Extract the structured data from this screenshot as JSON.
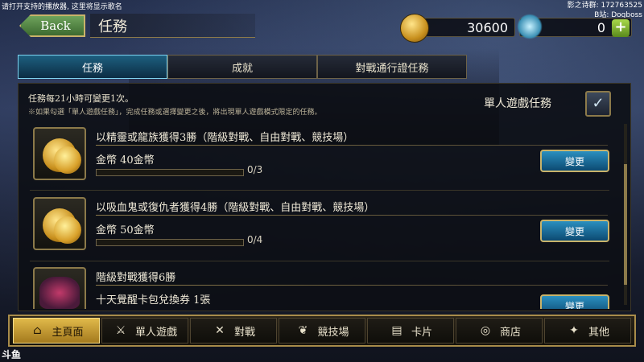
{
  "overlay": {
    "left_text": "请打开支持的播放器, 这里将显示歌名",
    "right_line1": "影之诗群: 172763525",
    "right_line2": "B站: Dogboss"
  },
  "header": {
    "back_label": "Back",
    "title": "任務",
    "gold_amount": "30600",
    "crystal_amount": "0",
    "plus_label": "+"
  },
  "tabs": [
    {
      "label": "任務",
      "active": true
    },
    {
      "label": "成就",
      "active": false
    },
    {
      "label": "對戰通行證任務",
      "active": false
    }
  ],
  "info": {
    "line1": "任務每21小時可變更1次。",
    "line2": "※如果勾選「單人遊戲任務」，完成任務或選擇變更之後，將出現單人遊戲模式限定的任務。",
    "solo_label": "單人遊戲任務",
    "solo_checked": true
  },
  "missions": [
    {
      "title": "以精靈或龍族獲得3勝（階級對戰、自由對戰、競技場）",
      "reward": "金幣 40金幣",
      "progress": "0/3",
      "progress_fraction": 0.0,
      "button": "變更",
      "icon": "gold-coins-icon"
    },
    {
      "title": "以吸血鬼或復仇者獲得4勝（階級對戰、自由對戰、競技場）",
      "reward": "金幣 50金幣",
      "progress": "0/4",
      "progress_fraction": 0.0,
      "button": "變更",
      "icon": "gold-coins-icon"
    },
    {
      "title": "階級對戰獲得6勝",
      "reward": "十天覺醒卡包兌換券 1張",
      "progress": "",
      "button": "變更",
      "icon": "card-pack-ticket-icon"
    }
  ],
  "nav": [
    {
      "label": "主頁面",
      "icon": "home-icon",
      "active": true
    },
    {
      "label": "單人遊戲",
      "icon": "single-player-icon",
      "active": false
    },
    {
      "label": "對戰",
      "icon": "crossed-swords-icon",
      "active": false
    },
    {
      "label": "競技場",
      "icon": "arena-wreath-icon",
      "active": false
    },
    {
      "label": "卡片",
      "icon": "cards-icon",
      "active": false
    },
    {
      "label": "商店",
      "icon": "shop-icon",
      "active": false
    },
    {
      "label": "其他",
      "icon": "other-icon",
      "active": false
    }
  ],
  "logo_text": "斗鱼",
  "colors": {
    "accent_blue": "#1d5f7f",
    "gold": "#c9b36a",
    "active_nav": "#e0b94a"
  }
}
